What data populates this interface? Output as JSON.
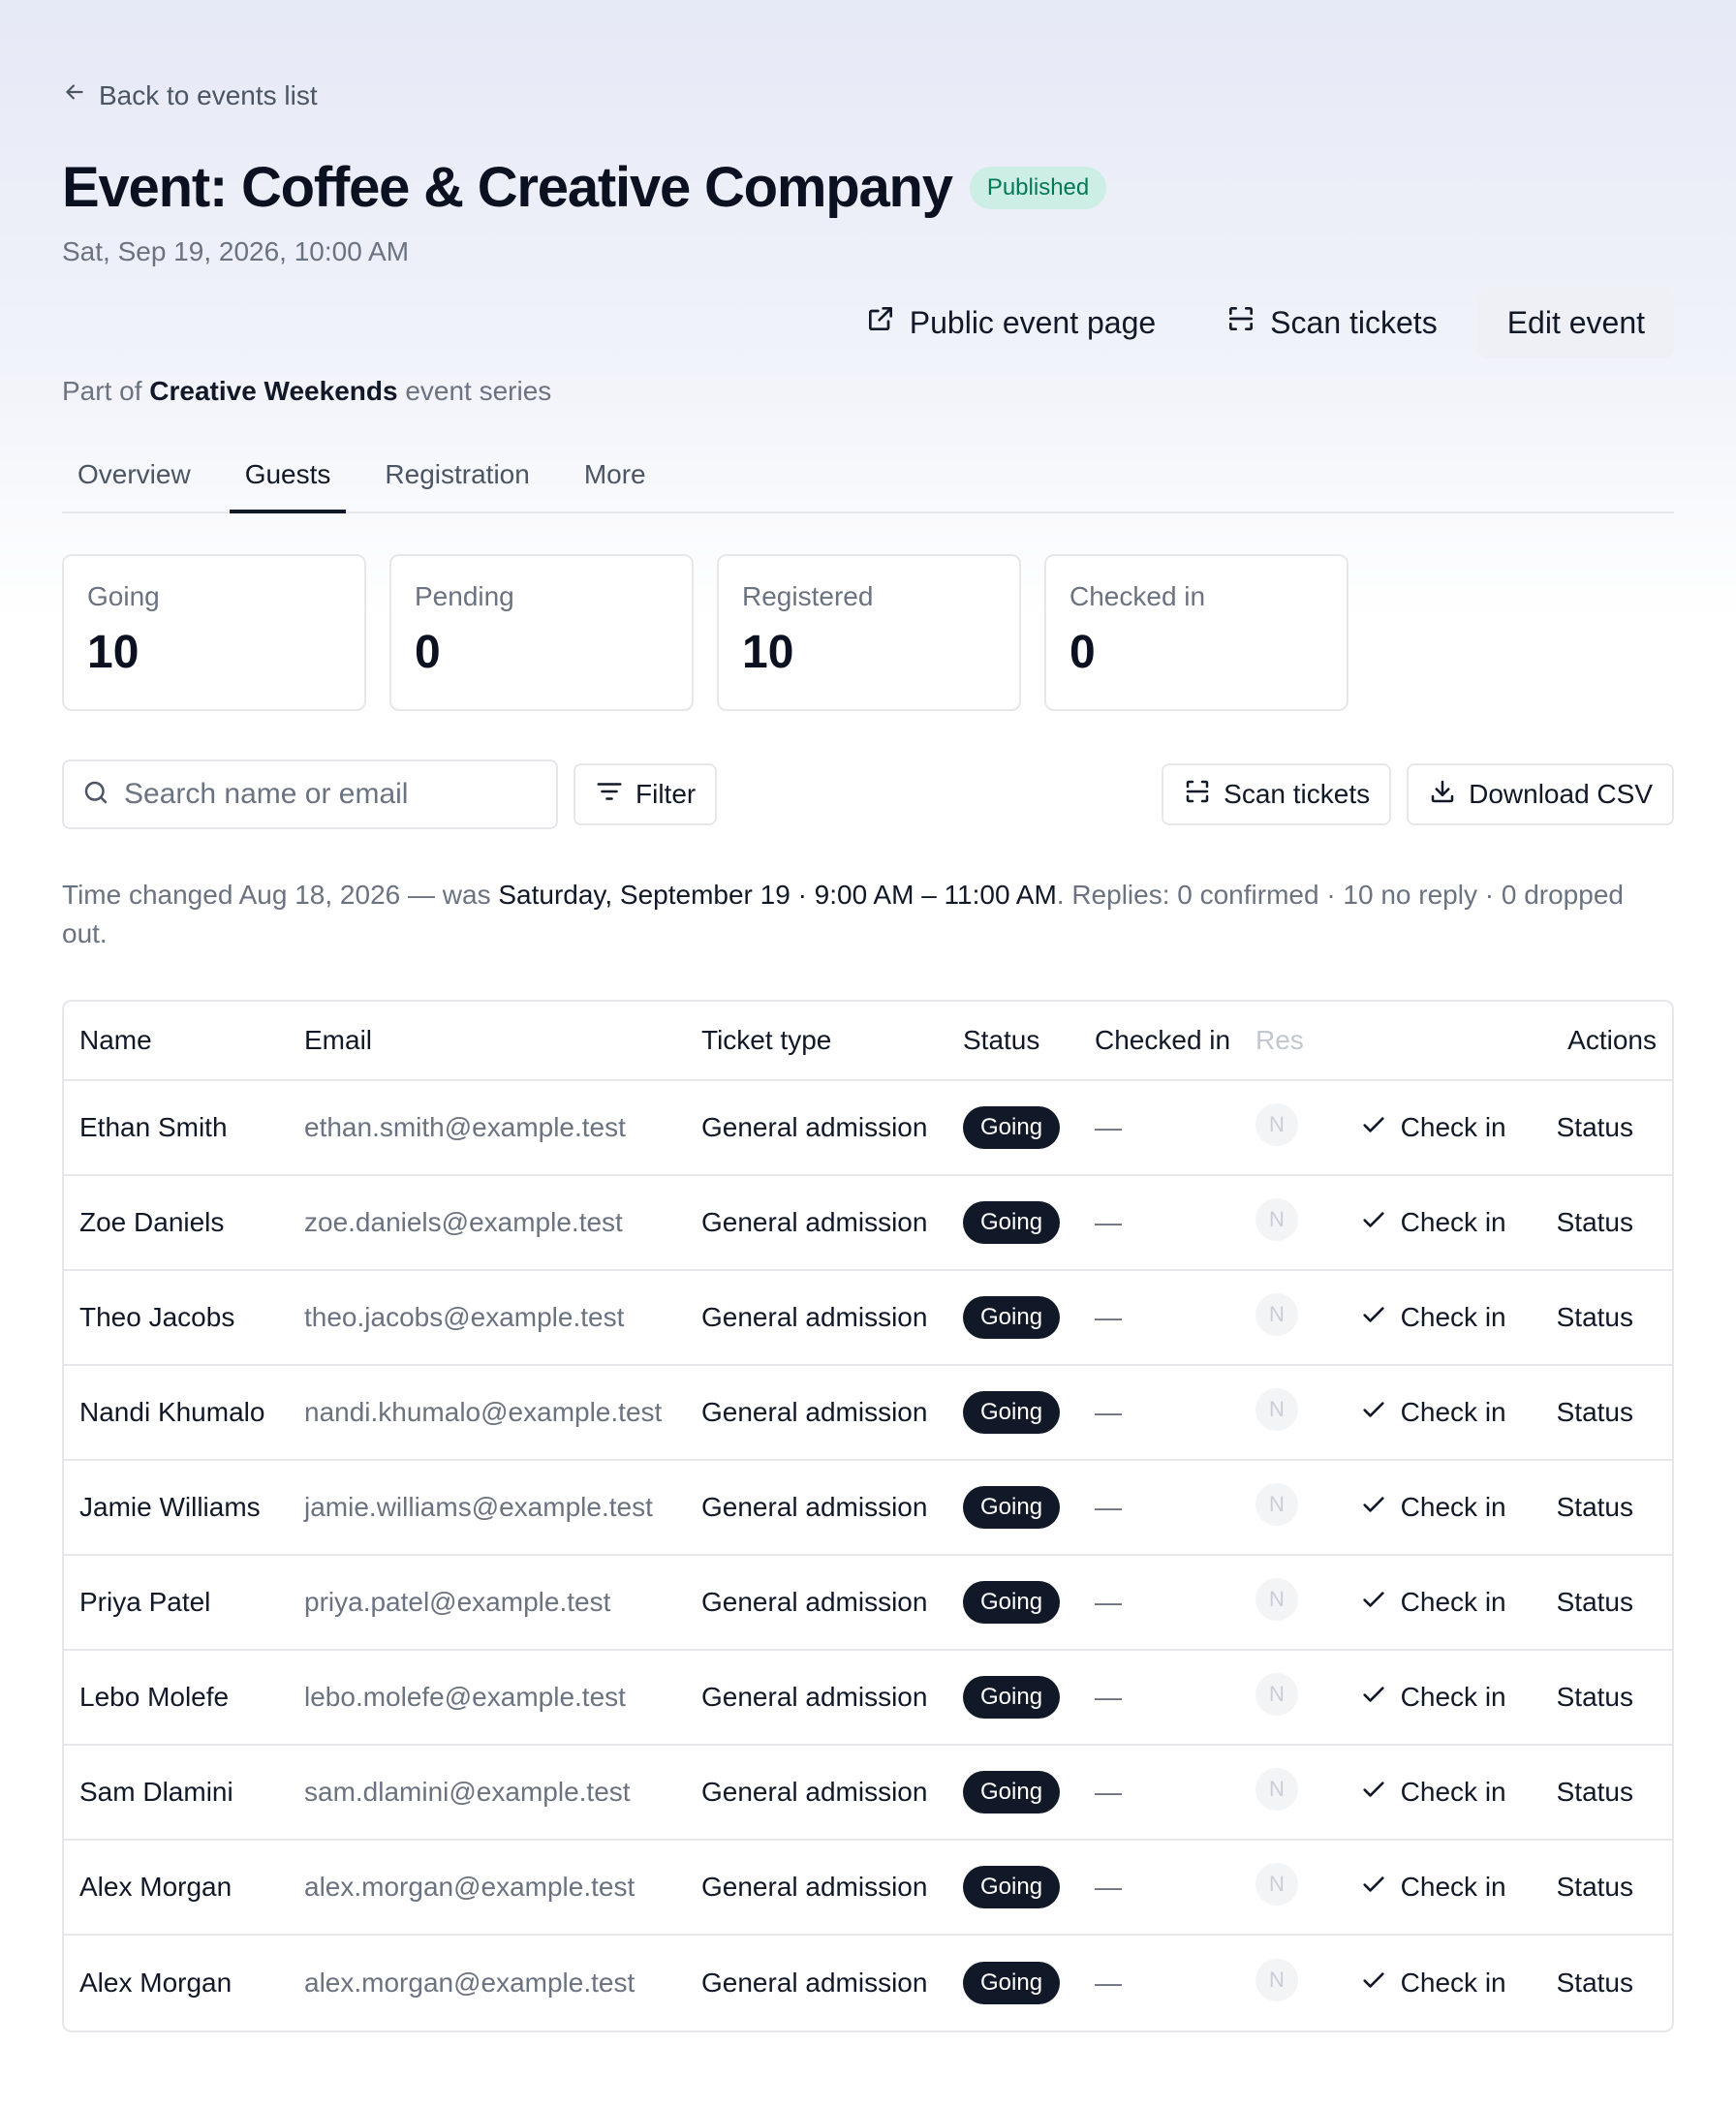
{
  "nav": {
    "back_label": "Back to events list"
  },
  "event": {
    "title": "Event: Coffee & Creative Company",
    "status_badge": "Published",
    "date": "Sat, Sep 19, 2026, 10:00 AM",
    "series_prefix": "Part of",
    "series_name": "Creative Weekends",
    "series_suffix": "event series"
  },
  "actions": {
    "public_page": "Public event page",
    "scan_tickets": "Scan tickets",
    "edit_event": "Edit event"
  },
  "tabs": [
    {
      "label": "Overview",
      "active": false
    },
    {
      "label": "Guests",
      "active": true
    },
    {
      "label": "Registration",
      "active": false
    },
    {
      "label": "More",
      "active": false
    }
  ],
  "stats": [
    {
      "label": "Going",
      "value": "10"
    },
    {
      "label": "Pending",
      "value": "0"
    },
    {
      "label": "Registered",
      "value": "10"
    },
    {
      "label": "Checked in",
      "value": "0"
    }
  ],
  "toolbar": {
    "search_placeholder": "Search name or email",
    "filter_label": "Filter",
    "scan_label": "Scan tickets",
    "download_label": "Download CSV"
  },
  "note": {
    "prefix": "Time changed Aug 18, 2026 — was",
    "was": "Saturday, September 19 · 9:00 AM – 11:00 AM",
    "suffix": ". Replies: 0 confirmed · 10 no reply · 0 dropped out."
  },
  "table": {
    "headers": {
      "name": "Name",
      "email": "Email",
      "ticket": "Ticket type",
      "status": "Status",
      "checked": "Checked in",
      "reply": "Res",
      "actions": "Actions"
    },
    "rows": [
      {
        "name": "Ethan Smith",
        "email": "ethan.smith@example.test",
        "ticket": "General admission",
        "status": "Going",
        "checked": "—",
        "reply": "N",
        "checkin": "Check in",
        "status_action": "Status"
      },
      {
        "name": "Zoe Daniels",
        "email": "zoe.daniels@example.test",
        "ticket": "General admission",
        "status": "Going",
        "checked": "—",
        "reply": "N",
        "checkin": "Check in",
        "status_action": "Status"
      },
      {
        "name": "Theo Jacobs",
        "email": "theo.jacobs@example.test",
        "ticket": "General admission",
        "status": "Going",
        "checked": "—",
        "reply": "N",
        "checkin": "Check in",
        "status_action": "Status"
      },
      {
        "name": "Nandi Khumalo",
        "email": "nandi.khumalo@example.test",
        "ticket": "General admission",
        "status": "Going",
        "checked": "—",
        "reply": "N",
        "checkin": "Check in",
        "status_action": "Status"
      },
      {
        "name": "Jamie Williams",
        "email": "jamie.williams@example.test",
        "ticket": "General admission",
        "status": "Going",
        "checked": "—",
        "reply": "N",
        "checkin": "Check in",
        "status_action": "Status"
      },
      {
        "name": "Priya Patel",
        "email": "priya.patel@example.test",
        "ticket": "General admission",
        "status": "Going",
        "checked": "—",
        "reply": "N",
        "checkin": "Check in",
        "status_action": "Status"
      },
      {
        "name": "Lebo Molefe",
        "email": "lebo.molefe@example.test",
        "ticket": "General admission",
        "status": "Going",
        "checked": "—",
        "reply": "N",
        "checkin": "Check in",
        "status_action": "Status"
      },
      {
        "name": "Sam Dlamini",
        "email": "sam.dlamini@example.test",
        "ticket": "General admission",
        "status": "Going",
        "checked": "—",
        "reply": "N",
        "checkin": "Check in",
        "status_action": "Status"
      },
      {
        "name": "Alex Morgan",
        "email": "alex.morgan@example.test",
        "ticket": "General admission",
        "status": "Going",
        "checked": "—",
        "reply": "N",
        "checkin": "Check in",
        "status_action": "Status"
      },
      {
        "name": "Alex Morgan",
        "email": "alex.morgan@example.test",
        "ticket": "General admission",
        "status": "Going",
        "checked": "—",
        "reply": "N",
        "checkin": "Check in",
        "status_action": "Status"
      }
    ]
  }
}
